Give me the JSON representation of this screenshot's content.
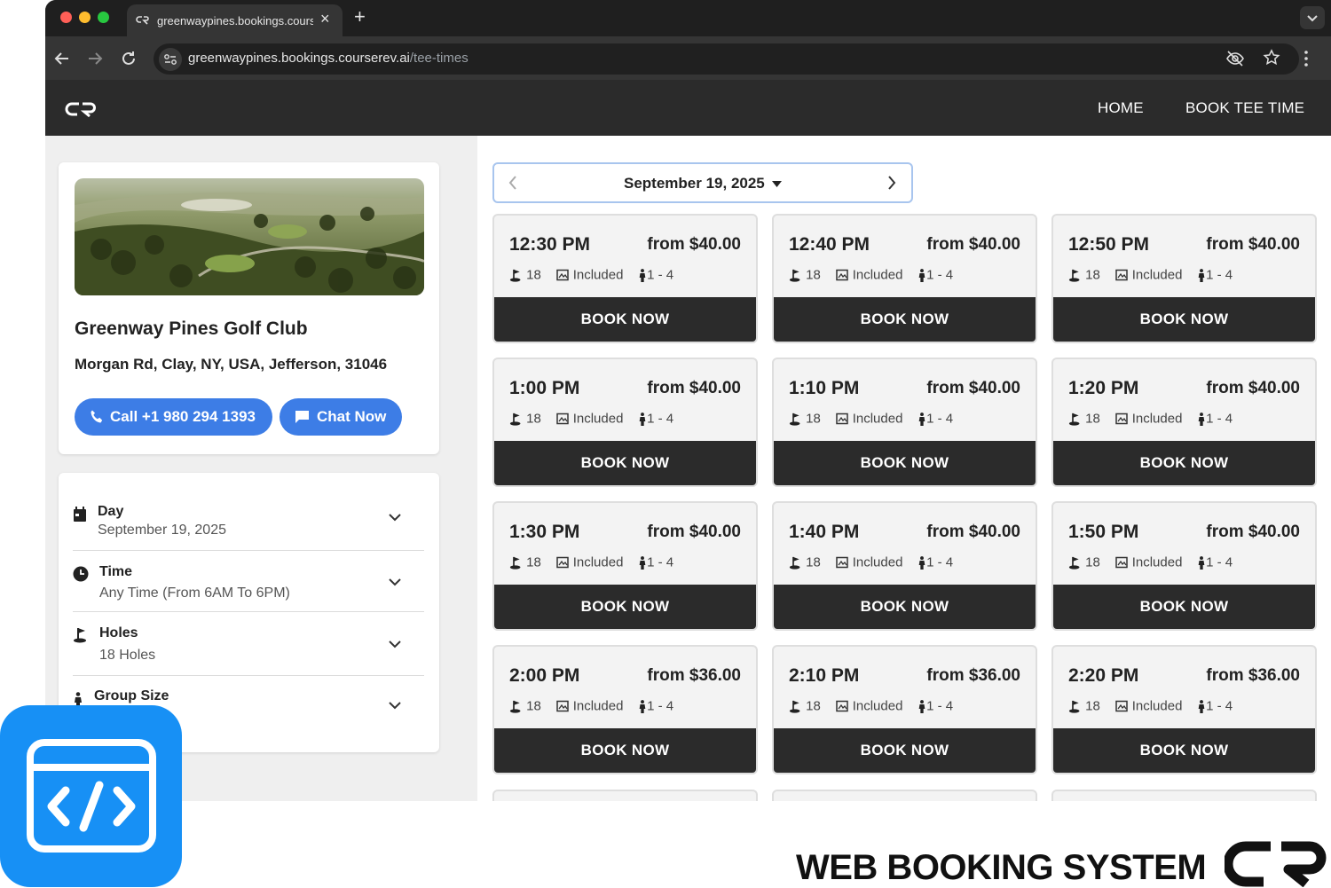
{
  "browser": {
    "tab_title": "greenwaypines.bookings.courserev.ai/tee-times",
    "url_host": "greenwaypines.bookings.courserev.ai",
    "url_path": "/tee-times"
  },
  "header": {
    "nav": [
      "HOME",
      "BOOK TEE TIME"
    ]
  },
  "course": {
    "name": "Greenway Pines Golf Club",
    "address": "Morgan Rd, Clay, NY, USA, Jefferson, 31046",
    "call_label": "Call +1 980 294 1393",
    "chat_label": "Chat Now"
  },
  "filters": [
    {
      "title": "Day",
      "value": "September 19, 2025",
      "icon": "calendar-icon"
    },
    {
      "title": "Time",
      "value": "Any Time (From 6AM To 6PM)",
      "icon": "clock-icon"
    },
    {
      "title": "Holes",
      "value": "18 Holes",
      "icon": "golf-flag-icon"
    },
    {
      "title": "Group Size",
      "value": "",
      "icon": "person-icon"
    }
  ],
  "date_picker": {
    "selected": "September 19, 2025"
  },
  "tee_times": [
    {
      "time": "12:30 PM",
      "price": "from $40.00",
      "holes": "18",
      "cart": "Included",
      "players": "1 - 4",
      "button": "BOOK NOW"
    },
    {
      "time": "12:40 PM",
      "price": "from $40.00",
      "holes": "18",
      "cart": "Included",
      "players": "1 - 4",
      "button": "BOOK NOW"
    },
    {
      "time": "12:50 PM",
      "price": "from $40.00",
      "holes": "18",
      "cart": "Included",
      "players": "1 - 4",
      "button": "BOOK NOW"
    },
    {
      "time": "1:00 PM",
      "price": "from $40.00",
      "holes": "18",
      "cart": "Included",
      "players": "1 - 4",
      "button": "BOOK NOW"
    },
    {
      "time": "1:10 PM",
      "price": "from $40.00",
      "holes": "18",
      "cart": "Included",
      "players": "1 - 4",
      "button": "BOOK NOW"
    },
    {
      "time": "1:20 PM",
      "price": "from $40.00",
      "holes": "18",
      "cart": "Included",
      "players": "1 - 4",
      "button": "BOOK NOW"
    },
    {
      "time": "1:30 PM",
      "price": "from $40.00",
      "holes": "18",
      "cart": "Included",
      "players": "1 - 4",
      "button": "BOOK NOW"
    },
    {
      "time": "1:40 PM",
      "price": "from $40.00",
      "holes": "18",
      "cart": "Included",
      "players": "1 - 4",
      "button": "BOOK NOW"
    },
    {
      "time": "1:50 PM",
      "price": "from $40.00",
      "holes": "18",
      "cart": "Included",
      "players": "1 - 4",
      "button": "BOOK NOW"
    },
    {
      "time": "2:00 PM",
      "price": "from $36.00",
      "holes": "18",
      "cart": "Included",
      "players": "1 - 4",
      "button": "BOOK NOW"
    },
    {
      "time": "2:10 PM",
      "price": "from $36.00",
      "holes": "18",
      "cart": "Included",
      "players": "1 - 4",
      "button": "BOOK NOW"
    },
    {
      "time": "2:20 PM",
      "price": "from $36.00",
      "holes": "18",
      "cart": "Included",
      "players": "1 - 4",
      "button": "BOOK NOW"
    }
  ],
  "branding": {
    "tagline": "WEB BOOKING SYSTEM"
  },
  "colors": {
    "accent": "#3d7de6",
    "dark": "#2b2b2b",
    "app_icon": "#1790f5"
  }
}
